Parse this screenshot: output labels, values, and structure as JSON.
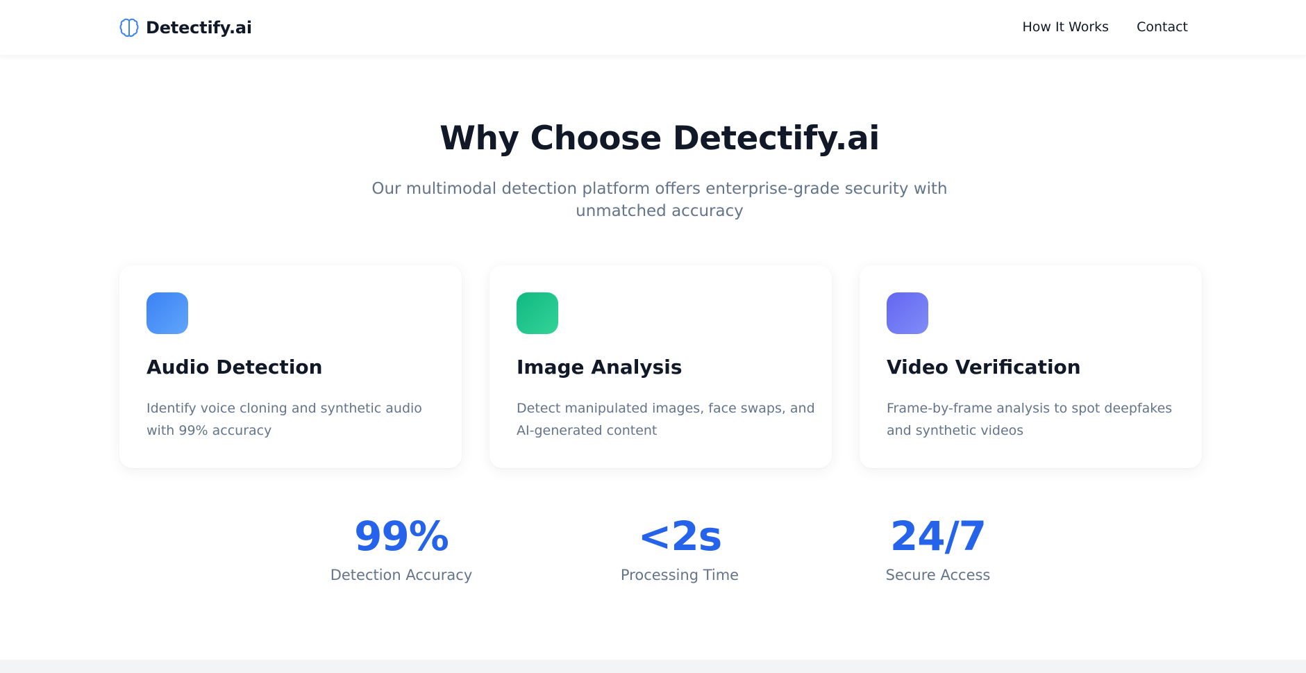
{
  "nav": {
    "brand_icon": "brain-icon",
    "brand_name": "Detectify.ai",
    "links": [
      "How It Works",
      "Contact"
    ]
  },
  "section": {
    "title": "Why Choose Detectify.ai",
    "subtitle": "Our multimodal detection platform offers enterprise-grade security with unmatched accuracy"
  },
  "features": [
    {
      "title": "Audio Detection",
      "description": "Identify voice cloning and synthetic audio with 99% accuracy",
      "icon_color_from": "#3b82f6",
      "icon_color_to": "#60a5fa"
    },
    {
      "title": "Image Analysis",
      "description": "Detect manipulated images, face swaps, and AI-generated content",
      "icon_color_from": "#10b981",
      "icon_color_to": "#34d399"
    },
    {
      "title": "Video Verification",
      "description": "Frame-by-frame analysis to spot deepfakes and synthetic videos",
      "icon_color_from": "#6366f1",
      "icon_color_to": "#818cf8"
    }
  ],
  "stats": [
    {
      "value": "99%",
      "label": "Detection Accuracy"
    },
    {
      "value": "<2s",
      "label": "Processing Time"
    },
    {
      "value": "24/7",
      "label": "Secure Access"
    }
  ],
  "colors": {
    "accent": "#2563eb",
    "heading": "#111827",
    "muted": "#64748b",
    "brand_icon": "#3b82f6"
  }
}
